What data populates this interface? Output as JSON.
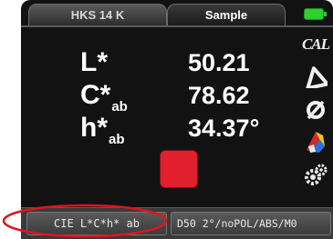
{
  "tabs": [
    {
      "label": "HKS 14 K",
      "active": false
    },
    {
      "label": "Sample",
      "active": true
    }
  ],
  "battery": {
    "color": "#2fcf2f"
  },
  "measurements": [
    {
      "symbol": "L*",
      "subscript": "",
      "value": "50.21"
    },
    {
      "symbol": "C*",
      "subscript": "ab",
      "value": "78.62"
    },
    {
      "symbol": "h*",
      "subscript": "ab",
      "value": "34.37°"
    }
  ],
  "swatch": {
    "color": "#e21f2c"
  },
  "side_icons": [
    {
      "name": "cal-icon",
      "label": "CAL"
    },
    {
      "name": "delta-icon"
    },
    {
      "name": "null-icon"
    },
    {
      "name": "color-palette-icon"
    },
    {
      "name": "settings-gears-icon"
    }
  ],
  "bottom": {
    "color_space_label": "CIE L*C*h* ab",
    "conditions_label": "D50 2°/noPOL/ABS/M0"
  },
  "annotation": {
    "color": "#e0141e"
  }
}
